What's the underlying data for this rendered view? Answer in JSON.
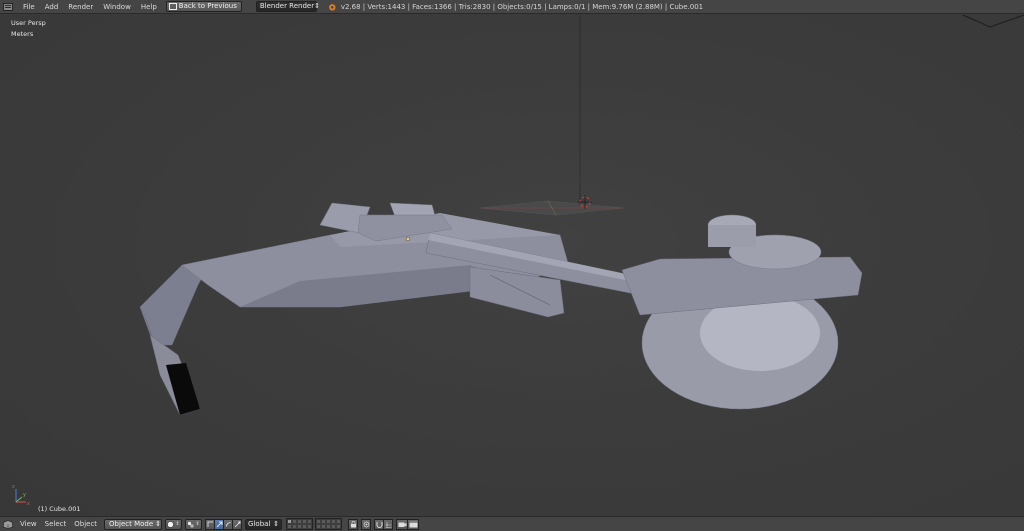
{
  "header": {
    "menus": [
      "File",
      "Add",
      "Render",
      "Window",
      "Help"
    ],
    "back_button": "Back to Previous",
    "render_engine": "Blender Render",
    "stats": "v2.68 | Verts:1443 | Faces:1366 | Tris:2830 | Objects:0/15 | Lamps:0/1 | Mem:9.76M (2.88M) | Cube.001"
  },
  "viewport": {
    "view_name": "User Persp",
    "units": "Meters",
    "active_object": "(1) Cube.001",
    "axes": {
      "x": "x",
      "y": "y",
      "z": "z"
    },
    "axis_colors": {
      "x": "#dc4b4b",
      "y": "#6fc04b",
      "z": "#4b7bdc"
    }
  },
  "footer": {
    "menus": [
      "View",
      "Select",
      "Object"
    ],
    "mode": "Object Mode",
    "orientation": "Global"
  },
  "colors": {
    "background": "#3b3b3b",
    "header": "#454545",
    "model": "#8e8f9e",
    "active_button": "#5a7cb0"
  }
}
